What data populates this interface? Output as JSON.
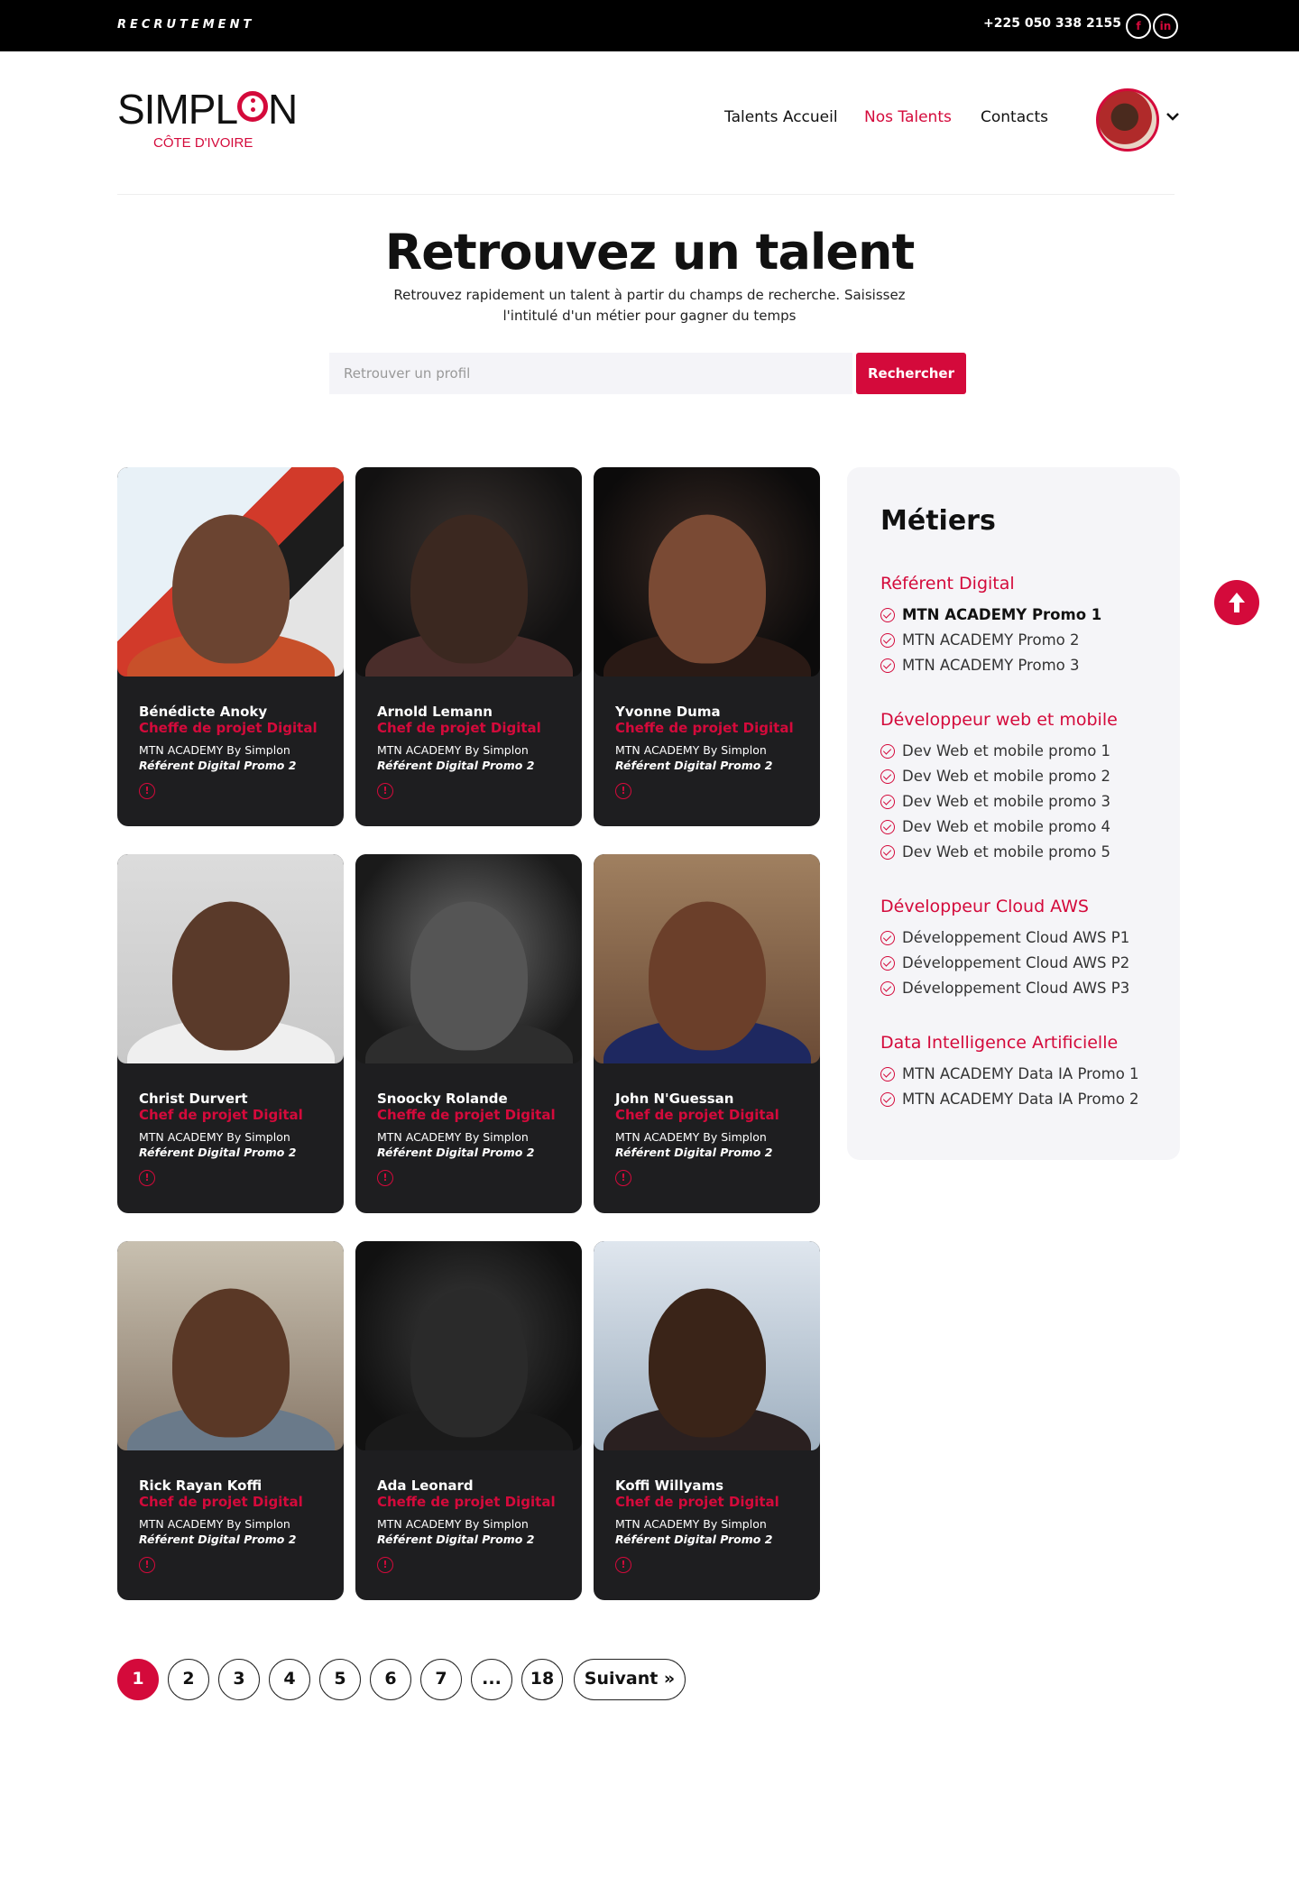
{
  "topbar": {
    "label": "RECRUTEMENT",
    "phone": "+225 050 338 2155",
    "social": [
      "f",
      "in"
    ]
  },
  "logo": {
    "word_left": "SIMPL",
    "word_right": "N",
    "subtitle": "CÔTE D'IVOIRE"
  },
  "nav": {
    "items": [
      "Talents Accueil",
      "Nos Talents",
      "Contacts"
    ],
    "active": "Nos Talents"
  },
  "hero": {
    "title": "Retrouvez un talent",
    "description": "Retrouvez rapidement un talent à partir du champs de recherche. Saisissez l'intitulé d'un métier pour gagner du temps",
    "search_placeholder": "Retrouver un profil",
    "search_button": "Rechercher"
  },
  "cards": [
    {
      "name": "Bénédicte Anoky",
      "role": "Cheffe de projet Digital",
      "org": "MTN ACADEMY By Simplon",
      "promo": "Référent Digital Promo 2"
    },
    {
      "name": "Arnold Lemann",
      "role": "Chef de projet Digital",
      "org": "MTN ACADEMY By Simplon",
      "promo": "Référent Digital Promo 2"
    },
    {
      "name": "Yvonne Duma",
      "role": "Cheffe de projet Digital",
      "org": "MTN ACADEMY By Simplon",
      "promo": "Référent Digital Promo 2"
    },
    {
      "name": "Christ Durvert",
      "role": "Chef de projet Digital",
      "org": "MTN ACADEMY By Simplon",
      "promo": "Référent Digital Promo 2"
    },
    {
      "name": "Snoocky Rolande",
      "role": "Cheffe de projet Digital",
      "org": "MTN ACADEMY By Simplon",
      "promo": "Référent Digital Promo 2"
    },
    {
      "name": "John N'Guessan",
      "role": "Chef de projet Digital",
      "org": "MTN ACADEMY By Simplon",
      "promo": "Référent Digital Promo 2"
    },
    {
      "name": "Rick Rayan Koffi",
      "role": "Chef de projet Digital",
      "org": "MTN ACADEMY By Simplon",
      "promo": "Référent Digital Promo 2"
    },
    {
      "name": "Ada Leonard",
      "role": "Cheffe de projet Digital",
      "org": "MTN ACADEMY By Simplon",
      "promo": "Référent Digital Promo 2"
    },
    {
      "name": "Koffi Willyams",
      "role": "Chef de projet Digital",
      "org": "MTN ACADEMY By Simplon",
      "promo": "Référent Digital Promo 2"
    }
  ],
  "sidebar": {
    "title": "Métiers",
    "groups": [
      {
        "title": "Référent Digital",
        "items": [
          "MTN ACADEMY Promo 1",
          "MTN ACADEMY Promo 2",
          "MTN ACADEMY Promo 3"
        ],
        "selected": "MTN ACADEMY Promo 1"
      },
      {
        "title": "Développeur web et mobile",
        "items": [
          "Dev Web et mobile promo 1",
          "Dev Web et mobile promo 2",
          "Dev Web et mobile promo 3",
          "Dev Web et mobile promo 4",
          "Dev Web et mobile promo 5"
        ]
      },
      {
        "title": "Développeur Cloud AWS",
        "items": [
          "Développement Cloud AWS P1",
          "Développement Cloud AWS P2",
          "Développement Cloud AWS P3"
        ]
      },
      {
        "title": "Data Intelligence Artificielle",
        "items": [
          "MTN ACADEMY Data IA Promo 1",
          "MTN ACADEMY Data IA Promo 2"
        ]
      }
    ]
  },
  "pagination": {
    "pages": [
      "1",
      "2",
      "3",
      "4",
      "5",
      "6",
      "7",
      "...",
      "18"
    ],
    "current": "1",
    "next": "Suivant »"
  },
  "colors": {
    "accent": "#d40a3b",
    "card_bg": "#1e1e20",
    "topbar_bg": "#000000",
    "sidebar_bg": "#f5f5f8"
  }
}
